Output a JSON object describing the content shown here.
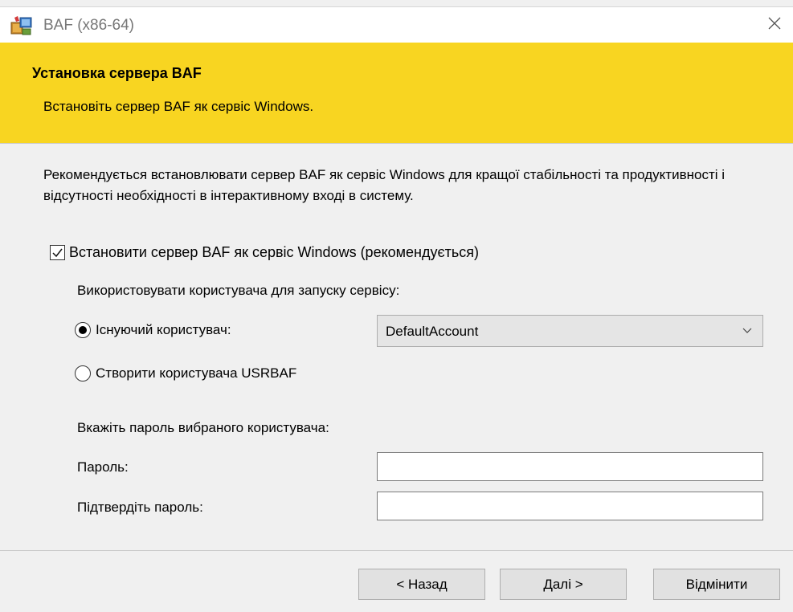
{
  "window": {
    "title": "BAF (x86-64)",
    "app_icon": "installer-icon",
    "close_icon": "close-icon"
  },
  "banner": {
    "title": "Установка сервера BAF",
    "subtitle": "Встановіть сервер BAF як сервіс Windows.",
    "background_color": "#f8d521"
  },
  "content": {
    "description": "Рекомендується встановлювати сервер BAF як сервіс Windows для кращої стабільності та продуктивності і відсутності необхідності в інтерактивному вході в систему.",
    "install_service_checkbox": {
      "label": "Встановити сервер BAF як сервіс Windows (рекомендується)",
      "checked": true
    },
    "user_section_label": "Використовувати користувача для запуску сервісу:",
    "existing_user_radio": {
      "label": "Існуючий користувач:",
      "selected": true
    },
    "user_select": {
      "value": "DefaultAccount"
    },
    "create_user_radio": {
      "label": "Створити користувача USRBAF",
      "selected": false
    },
    "password_section_label": "Вкажіть пароль вибраного користувача:",
    "password_field": {
      "label": "Пароль:",
      "value": ""
    },
    "confirm_password_field": {
      "label": "Підтвердіть пароль:",
      "value": ""
    }
  },
  "footer": {
    "back_label": "< Назад",
    "next_label": "Далі >",
    "cancel_label": "Відмінити"
  }
}
